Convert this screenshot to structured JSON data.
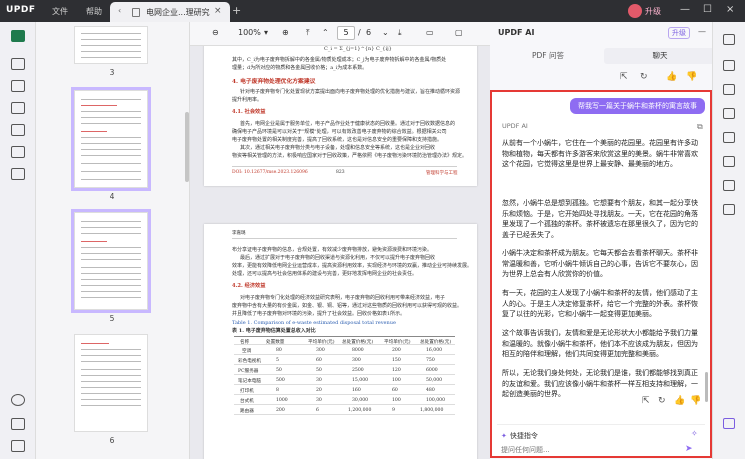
{
  "titlebar": {
    "logo": "UPDF",
    "menu": [
      "文件",
      "帮助"
    ],
    "tab_label": "电网企业...理研究",
    "tab_close": "×",
    "add_tab": "+",
    "upgrade_label": "升级",
    "window_buttons": [
      "—",
      "☐",
      "×"
    ]
  },
  "thumbnails": {
    "pages": [
      "3",
      "4",
      "5",
      "6"
    ]
  },
  "doc_toolbar": {
    "zoom": "100%",
    "current_page": "5",
    "page_sep": "/",
    "total_pages": "6"
  },
  "doc": {
    "page1_formula": "C_i = Σ_{j=1}^{n} C_{ij}",
    "page1_text1": "其中，C_i为电子废弃物拆解中的各金属/物质处理成本；C_j为电子废弃物拆解中的各金属/物质处",
    "page1_text2": "理量；d为所对应的物质和各金属回收价格；a_i为成本系数。",
    "page1_heading": "4. 电子废弃物处理优化方案建议",
    "page1_text3": "针对电子废弃物专门化处置现状方案提出面向电子废弃物处理的优化措施与建议，旨在推动循环资源",
    "page1_text4": "提升利用率。",
    "page1_sub": "4.1. 社会效益",
    "page1_text5": "首先，电网企业是属于服务单位，电子产品作业处于健康状态的回收量。通过对于回收数据信息的",
    "page1_text6": "确保电子产品环境是可以对关于\"规模\"处理，可以有效改善电子废弃物的综合效益。根据相关公司",
    "page1_text7": "电子废弃物处置的相关制度完善，提高了回收系统，这也是对信息安全的重要保障和支持措施。",
    "page1_text8": "其次，通过相关电子废弃物分类与电子设备，处理和信息安全等系统，这也是企业对回收",
    "page1_text9": "物资等相关管理的方法，积极响应国家对于回收政策，严格依照《电子废物污染环境防治管理办法》规定。",
    "page1_footer_left": "DOI: 10.12677/mse.2023.126096",
    "page1_footer_mid": "823",
    "page1_footer_right": "管理科学与工程",
    "page2_header": "李嘉璐",
    "page2_text1": "布分享证电子废弃物的信息，合规处置，有效减少废弃物排放，避免资源浪费和环境污染。",
    "page2_text2": "最后，通过扩展对于电子废弃物的回收渠道与资源化利用，不仅可以提升电子废弃物回收",
    "page2_text3": "效率，更能有效降低电网企业运营成本，提高资源利用效率，实现经济与环境的双赢，推动企业可持续发展。",
    "page2_text4": "处理，还可以提高与社会信用体系的建设与完善，更好地发挥电网企业的社会责任。",
    "page2_sub": "4.2. 经济效益",
    "page2_text5": "对电子废弃物专门化处理的经济效益研究表明，电子废弃物的回收利用可带来经济效益，电子",
    "page2_text6": "废弃物中含有大量的有价金属，如金、银、铜、铝等，通过对这些物质的回收利用可以获得可观的收益。",
    "page2_text7": "并且降低了电子废弃物对环境的污染，提升了社会效益。回收价格如表1所示。",
    "table_caption_en": "Table 1. Comparison of e-waste estimated disposal total revenue",
    "table_caption_cn": "表 1. 电子废弃物估算处置总收入对比",
    "table_head": [
      "名称",
      "处置数量",
      "平均单价(元)",
      "总处置价格(元)",
      "平均单价(元)",
      "总处置价格(元)"
    ],
    "table_rows": [
      [
        "空调",
        "80",
        "300",
        "8000",
        "200",
        "16,000"
      ],
      [
        "彩色电视机",
        "5",
        "60",
        "300",
        "150",
        "750"
      ],
      [
        "PC服务器",
        "50",
        "50",
        "2500",
        "120",
        "6000"
      ],
      [
        "笔记本电脑",
        "500",
        "30",
        "15,000",
        "100",
        "50,000"
      ],
      [
        "打印机",
        "8",
        "20",
        "160",
        "60",
        "480"
      ],
      [
        "台式机",
        "1000",
        "30",
        "30,000",
        "100",
        "100,000"
      ],
      [
        "路由器",
        "200",
        "6",
        "1,200,000",
        "9",
        "1,800,000"
      ]
    ]
  },
  "ai": {
    "logo": "UPDF AI",
    "upgrade": "升级",
    "tabs": [
      "PDF 问答",
      "聊天"
    ],
    "user_message": "帮我写一篇关于蜗牛和茶杯的寓言故事",
    "ai_label": "UPDF AI",
    "answer": [
      "从前有一个小蜗牛，它住在一个美丽的花园里。花园里有许多动物和植物，每天都有许多游客来欣赏这里的美景。蜗牛非常喜欢这个花园，它觉得这里是世界上最安静、最美丽的地方。",
      "忽然，小蜗牛总是想到孤独。它想要有个朋友，和其一起分享快乐和烦恼。于是，它开始四处寻找朋友。一天，它在花园的角落里发现了一个孤独的茶杯。茶杯被遗忘在那里很久了，因为它的盖子已经丢失了。",
      "小蜗牛决定和茶杯成为朋友。它每天都会去看茶杯聊天。茶杯非常温暖和善，它听小蜗牛倾诉自己的心事，告诉它不要灰心，因为世界上总会有人欣赏你的价值。",
      "有一天，花园的主人发现了小蜗牛和茶杯的友情，他们感动了主人的心。于是主人决定修复茶杯，给它一个完整的外表。茶杯恢复了以往的光彩，它和小蜗牛一起变得更加美丽。",
      "这个故事告诉我们，友情和爱是无论形状大小都能给予我们力量和温暖的。就像小蜗牛和茶杯，他们本不应该成为朋友，但因为相互的陪伴和理解，他们共同变得更加完整和美丽。",
      "所以，无论我们身处何处，无论我们是谁，我们都能够找到真正的友谊和爱。我们应该像小蜗牛和茶杯一样互相支持和理解，一起创造美丽的世界。"
    ],
    "quick_prompts": "快捷指令",
    "input_placeholder": "提问任何问题..."
  }
}
